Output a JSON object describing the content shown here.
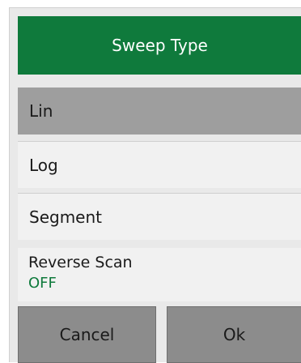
{
  "dialog": {
    "title": "Sweep Type",
    "options": [
      {
        "label": "Lin",
        "selected": true
      },
      {
        "label": "Log",
        "selected": false
      },
      {
        "label": "Segment",
        "selected": false
      }
    ],
    "reverse_scan": {
      "label": "Reverse Scan",
      "value": "OFF"
    },
    "buttons": {
      "cancel": "Cancel",
      "ok": "Ok"
    }
  },
  "colors": {
    "header_bg": "#0f7a3c",
    "selected_bg": "#9e9e9e",
    "value_text": "#0f7a3c",
    "button_bg": "#8c8c8c"
  }
}
